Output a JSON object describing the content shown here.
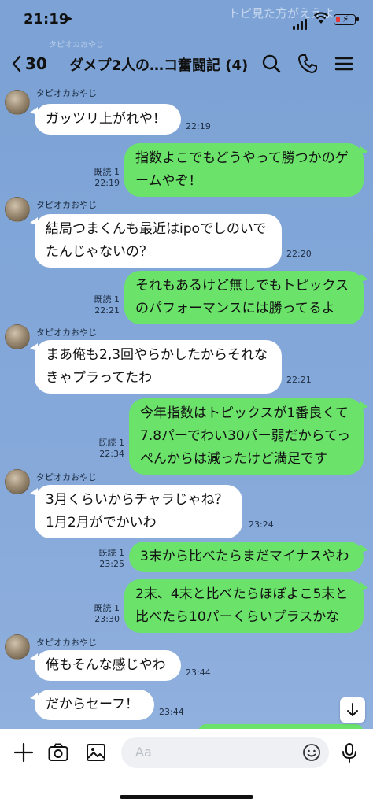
{
  "status_bar": {
    "time": "21:19",
    "ghost_text": "トピ見た方がええよ"
  },
  "header": {
    "back_count": "30",
    "title": "ダメプ2人の…コ奮闘記 (4)",
    "ghost_sender": "タピオカおやじ"
  },
  "messages": [
    {
      "dir": "in",
      "sender": "タピオカおやじ",
      "lines": [
        "ガッツリ上がれや！"
      ],
      "time": "22:19"
    },
    {
      "dir": "out",
      "read": "既読 1",
      "lines": [
        "指数よこでもどうやって勝つかのゲ",
        "ームやぞ！"
      ],
      "time": "22:19"
    },
    {
      "dir": "in",
      "sender": "タピオカおやじ",
      "lines": [
        "結局つまくんも最近はipoでしのいで",
        "たんじゃないの？"
      ],
      "time": "22:20"
    },
    {
      "dir": "out",
      "read": "既読 1",
      "lines": [
        "それもあるけど無しでもトピックス",
        "のパフォーマンスには勝ってるよ"
      ],
      "time": "22:21"
    },
    {
      "dir": "in",
      "sender": "タピオカおやじ",
      "lines": [
        "まあ俺も2,3回やらかしたからそれな",
        "きゃプラってたわ"
      ],
      "time": "22:21"
    },
    {
      "dir": "out",
      "read": "既読 1",
      "lines": [
        "今年指数はトピックスが1番良くて",
        "7.8パーでわい30パー弱だからてっ",
        "ぺんからは減ったけど満足です"
      ],
      "time": "22:34"
    },
    {
      "dir": "in",
      "sender": "タピオカおやじ",
      "lines": [
        "3月くらいからチャラじゃね？",
        "1月2月がでかいわ"
      ],
      "time": "23:24"
    },
    {
      "dir": "out",
      "read": "既読 1",
      "lines": [
        "3末から比べたらまだマイナスやわ"
      ],
      "time": "23:25"
    },
    {
      "dir": "out",
      "read": "既読 1",
      "lines": [
        "2末、4末と比べたらほぼよこ5末と",
        "比べたら10パーくらいプラスかな"
      ],
      "time": "23:30"
    },
    {
      "dir": "in",
      "sender": "タピオカおやじ",
      "lines": [
        "俺もそんな感じやわ"
      ],
      "time": "23:44"
    },
    {
      "dir": "in",
      "lines": [
        "だからセーフ！"
      ],
      "time": "23:44"
    }
  ],
  "composer": {
    "placeholder": "Aa"
  },
  "icons": [
    "chevron-left-icon",
    "search-icon",
    "phone-icon",
    "menu-icon",
    "plus-icon",
    "camera-icon",
    "image-icon",
    "emoji-icon",
    "mic-icon",
    "arrow-down-icon"
  ],
  "colors": {
    "chat_bg": "#7da3d6",
    "outgoing_bubble": "#6be26a",
    "incoming_bubble": "#ffffff"
  }
}
